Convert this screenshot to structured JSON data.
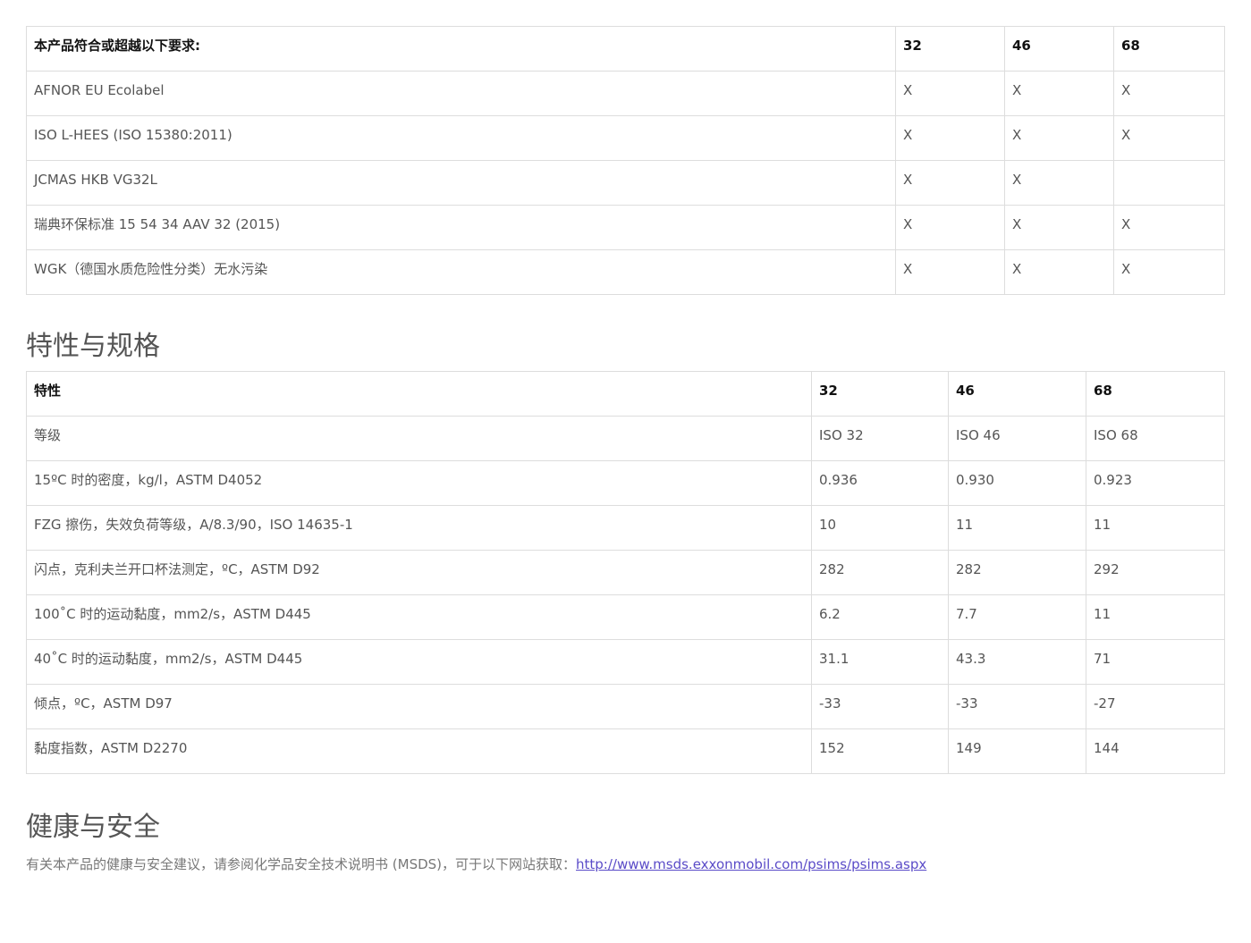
{
  "requirements": {
    "header": [
      "本产品符合或超越以下要求:",
      "32",
      "46",
      "68"
    ],
    "rows": [
      [
        "AFNOR EU Ecolabel",
        "X",
        "X",
        "X"
      ],
      [
        "ISO L-HEES (ISO 15380:2011)",
        "X",
        "X",
        "X"
      ],
      [
        "JCMAS HKB VG32L",
        "X",
        "X",
        ""
      ],
      [
        "瑞典环保标准 15 54 34 AAV 32 (2015)",
        "X",
        "X",
        "X"
      ],
      [
        "WGK（德国水质危险性分类）无水污染",
        "X",
        "X",
        "X"
      ]
    ]
  },
  "properties": {
    "title": "特性与规格",
    "header": [
      "特性",
      "32",
      "46",
      "68"
    ],
    "rows": [
      [
        "等级",
        "ISO 32",
        "ISO 46",
        "ISO 68"
      ],
      [
        "15ºC 时的密度，kg/l，ASTM D4052",
        "0.936",
        "0.930",
        "0.923"
      ],
      [
        "FZG 擦伤，失效负荷等级，A/8.3/90，ISO 14635-1",
        "10",
        "11",
        "11"
      ],
      [
        "闪点，克利夫兰开口杯法测定，ºC，ASTM D92",
        "282",
        "282",
        "292"
      ],
      [
        "100˚C 时的运动黏度，mm2/s，ASTM D445",
        "6.2",
        "7.7",
        "11"
      ],
      [
        "40˚C 时的运动黏度，mm2/s，ASTM D445",
        "31.1",
        "43.3",
        "71"
      ],
      [
        "倾点，ºC，ASTM D97",
        "-33",
        "-33",
        "-27"
      ],
      [
        "黏度指数，ASTM D2270",
        "152",
        "149",
        "144"
      ]
    ]
  },
  "health": {
    "title": "健康与安全",
    "text": "有关本产品的健康与安全建议，请参阅化学品安全技术说明书 (MSDS)，可于以下网站获取：",
    "link": "http://www.msds.exxonmobil.com/psims/psims.aspx"
  }
}
